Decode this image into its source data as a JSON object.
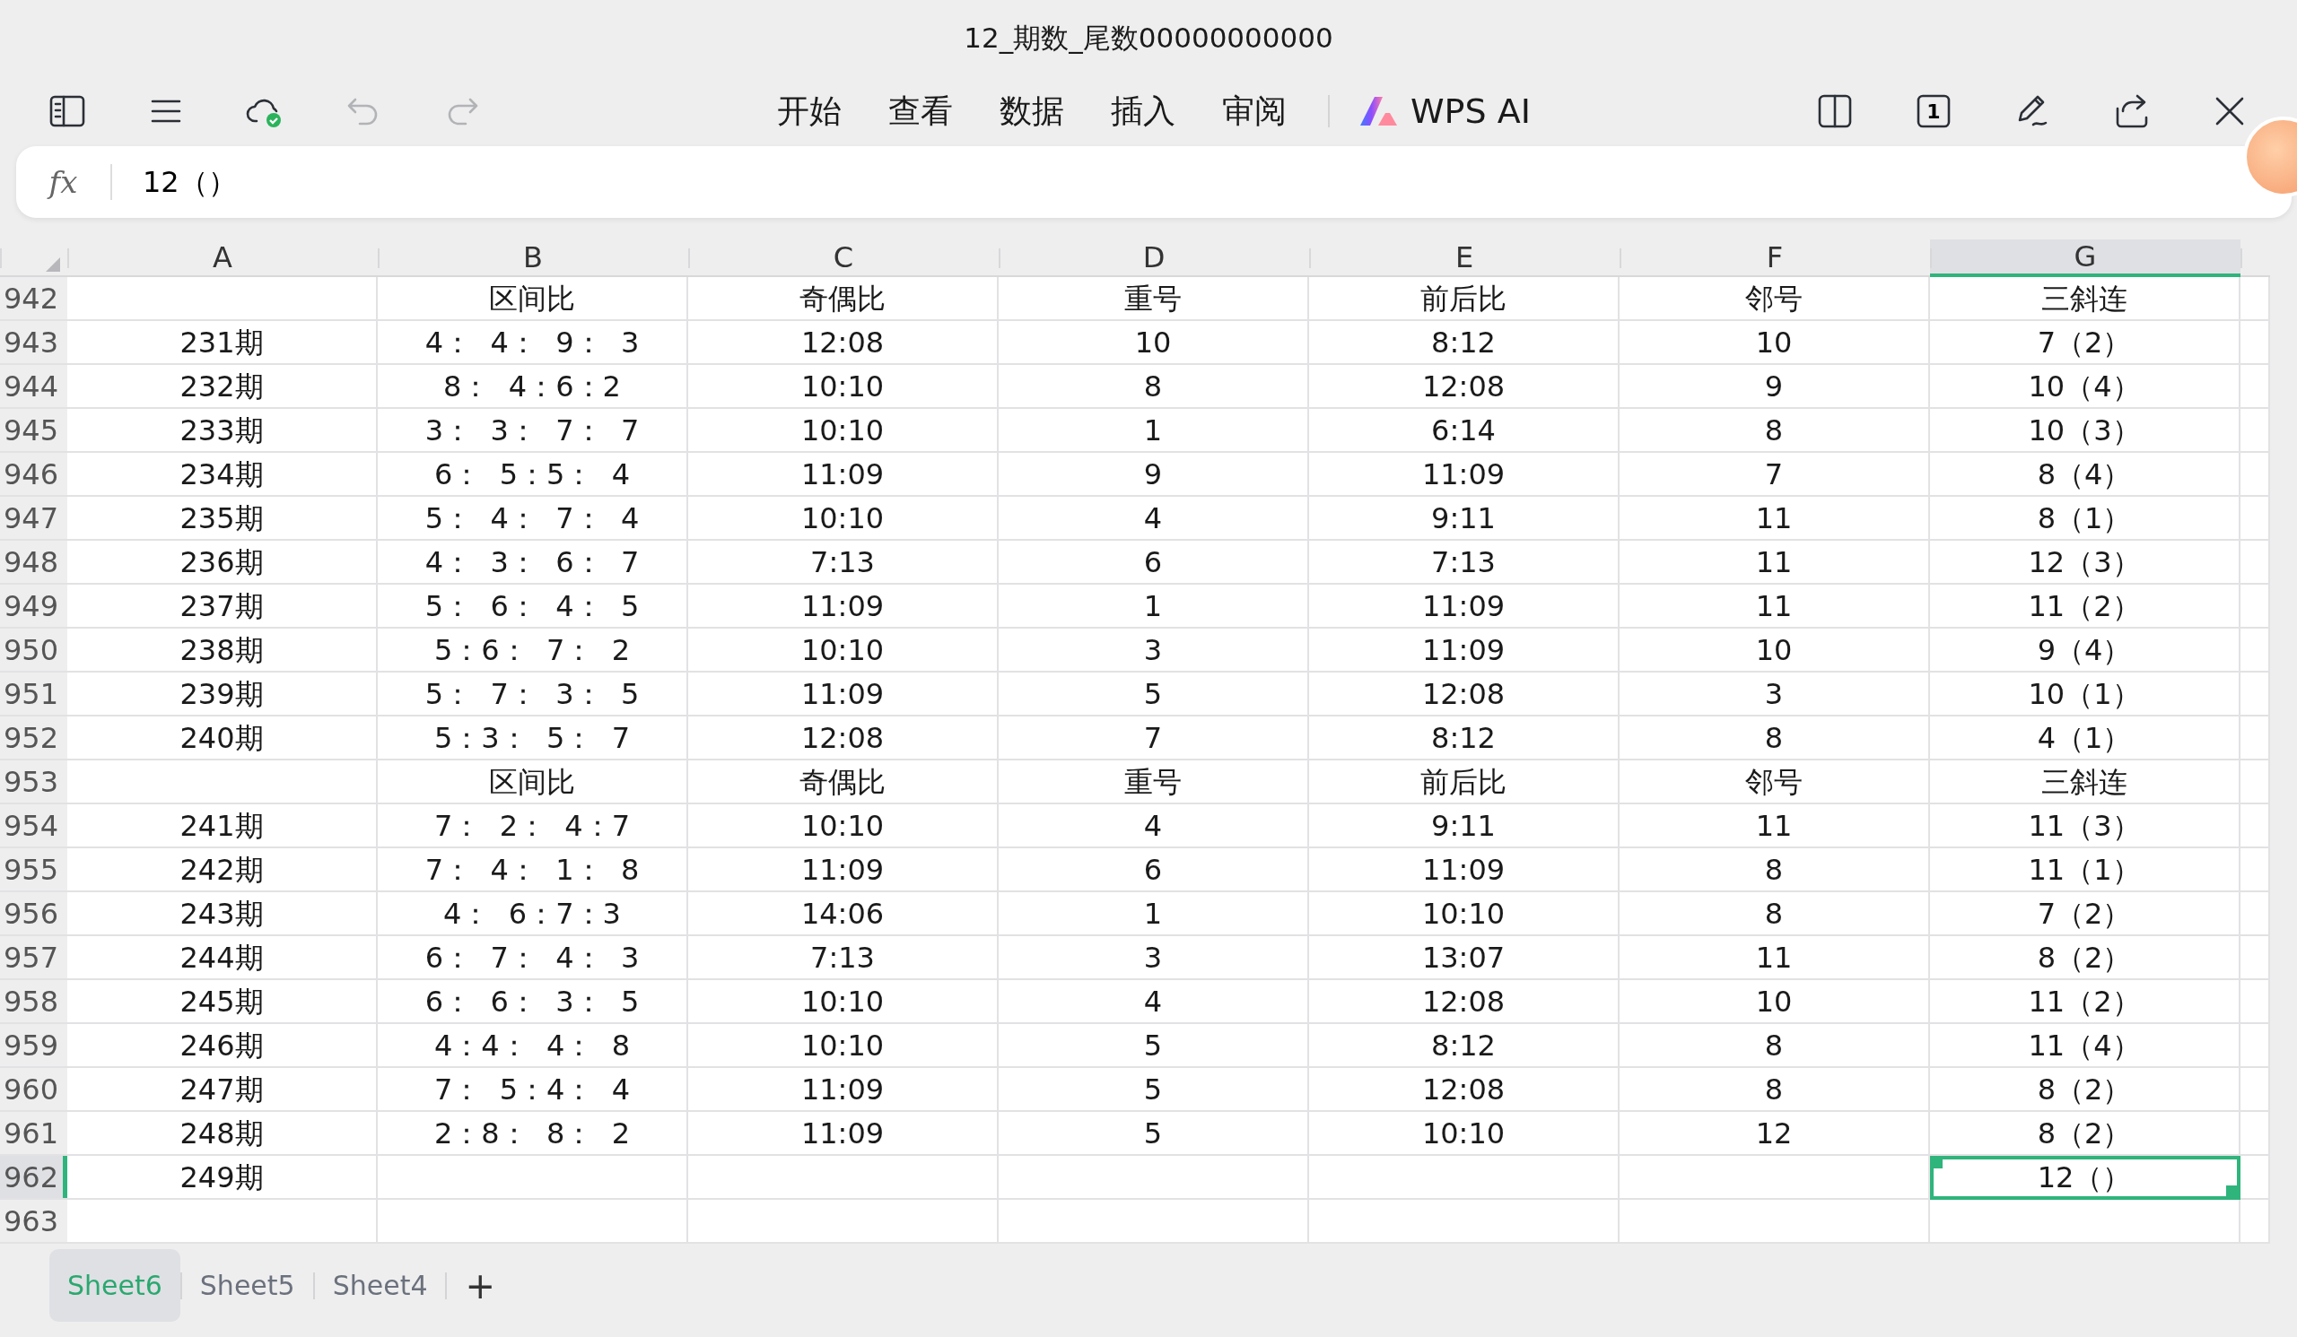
{
  "window": {
    "title": "12_期数_尾数00000000000"
  },
  "toolbar_left": [
    {
      "kind": "sidebar",
      "disabled": false
    },
    {
      "kind": "menu",
      "disabled": false
    },
    {
      "kind": "cloud",
      "disabled": false
    },
    {
      "kind": "undo",
      "disabled": true
    },
    {
      "kind": "redo",
      "disabled": true
    }
  ],
  "menu": [
    {
      "label": "开始"
    },
    {
      "label": "查看"
    },
    {
      "label": "数据"
    },
    {
      "label": "插入"
    },
    {
      "label": "审阅"
    }
  ],
  "ai_button": {
    "label": "WPS AI"
  },
  "toolbar_right": [
    {
      "kind": "split"
    },
    {
      "kind": "page"
    },
    {
      "kind": "pen"
    },
    {
      "kind": "share"
    },
    {
      "kind": "close"
    }
  ],
  "page_badge": "1",
  "formula_bar": {
    "label": "fx",
    "value": "12（）"
  },
  "sheet": {
    "columns": [
      {
        "label": "A",
        "selected": false
      },
      {
        "label": "B",
        "selected": false
      },
      {
        "label": "C",
        "selected": false
      },
      {
        "label": "D",
        "selected": false
      },
      {
        "label": "E",
        "selected": false
      },
      {
        "label": "F",
        "selected": false
      },
      {
        "label": "G",
        "selected": true
      }
    ],
    "rows": [
      {
        "number": "942",
        "selected": false,
        "cells": [
          "",
          "区间比",
          "奇偶比",
          "重号",
          "前后比",
          "邻号",
          "三斜连"
        ]
      },
      {
        "number": "943",
        "selected": false,
        "cells": [
          "231期",
          "4：  4：  9：  3",
          "12:08",
          "10",
          "8:12",
          "10",
          "7（2）"
        ]
      },
      {
        "number": "944",
        "selected": false,
        "cells": [
          "232期",
          "8：  4：6：2",
          "10:10",
          "8",
          "12:08",
          "9",
          "10（4）"
        ]
      },
      {
        "number": "945",
        "selected": false,
        "cells": [
          "233期",
          "3：  3：  7：  7",
          "10:10",
          "1",
          "6:14",
          "8",
          "10（3）"
        ]
      },
      {
        "number": "946",
        "selected": false,
        "cells": [
          "234期",
          "6：  5：5：  4",
          "11:09",
          "9",
          "11:09",
          "7",
          "8（4）"
        ]
      },
      {
        "number": "947",
        "selected": false,
        "cells": [
          "235期",
          "5：  4：  7：  4",
          "10:10",
          "4",
          "9:11",
          "11",
          "8（1）"
        ]
      },
      {
        "number": "948",
        "selected": false,
        "cells": [
          "236期",
          "4：  3：  6：  7",
          "7:13",
          "6",
          "7:13",
          "11",
          "12（3）"
        ]
      },
      {
        "number": "949",
        "selected": false,
        "cells": [
          "237期",
          "5：  6：  4：  5",
          "11:09",
          "1",
          "11:09",
          "11",
          "11（2）"
        ]
      },
      {
        "number": "950",
        "selected": false,
        "cells": [
          "238期",
          "5：6：  7：  2",
          "10:10",
          "3",
          "11:09",
          "10",
          "9（4）"
        ]
      },
      {
        "number": "951",
        "selected": false,
        "cells": [
          "239期",
          "5：  7：  3：  5",
          "11:09",
          "5",
          "12:08",
          "3",
          "10（1）"
        ]
      },
      {
        "number": "952",
        "selected": false,
        "cells": [
          "240期",
          "5：3：  5：  7",
          "12:08",
          "7",
          "8:12",
          "8",
          "4（1）"
        ]
      },
      {
        "number": "953",
        "selected": false,
        "cells": [
          "",
          "区间比",
          "奇偶比",
          "重号",
          "前后比",
          "邻号",
          "三斜连"
        ]
      },
      {
        "number": "954",
        "selected": false,
        "cells": [
          "241期",
          "7：  2：  4：7",
          "10:10",
          "4",
          "9:11",
          "11",
          "11（3）"
        ]
      },
      {
        "number": "955",
        "selected": false,
        "cells": [
          "242期",
          "7：  4：  1：  8",
          "11:09",
          "6",
          "11:09",
          "8",
          "11（1）"
        ]
      },
      {
        "number": "956",
        "selected": false,
        "cells": [
          "243期",
          "4：  6：7：3",
          "14:06",
          "1",
          "10:10",
          "8",
          "7（2）"
        ]
      },
      {
        "number": "957",
        "selected": false,
        "cells": [
          "244期",
          "6：  7：  4：  3",
          "7:13",
          "3",
          "13:07",
          "11",
          "8（2）"
        ]
      },
      {
        "number": "958",
        "selected": false,
        "cells": [
          "245期",
          "6：  6：  3：  5",
          "10:10",
          "4",
          "12:08",
          "10",
          "11（2）"
        ]
      },
      {
        "number": "959",
        "selected": false,
        "cells": [
          "246期",
          "4：4：  4：  8",
          "10:10",
          "5",
          "8:12",
          "8",
          "11（4）"
        ]
      },
      {
        "number": "960",
        "selected": false,
        "cells": [
          "247期",
          "7：  5：4：  4",
          "11:09",
          "5",
          "12:08",
          "8",
          "8（2）"
        ]
      },
      {
        "number": "961",
        "selected": false,
        "cells": [
          "248期",
          "2：8：  8：  2",
          "11:09",
          "5",
          "10:10",
          "12",
          "8（2）"
        ]
      },
      {
        "number": "962",
        "selected": true,
        "cells": [
          "249期",
          "",
          "",
          "",
          "",
          "",
          "12（）"
        ]
      },
      {
        "number": "963",
        "selected": false,
        "cells": [
          "",
          "",
          "",
          "",
          "",
          "",
          ""
        ]
      }
    ]
  },
  "sheet_tabs": [
    {
      "label": "Sheet6",
      "selected": true
    },
    {
      "label": "Sheet5",
      "selected": false
    },
    {
      "label": "Sheet4",
      "selected": false
    }
  ],
  "add_sheet": "+"
}
